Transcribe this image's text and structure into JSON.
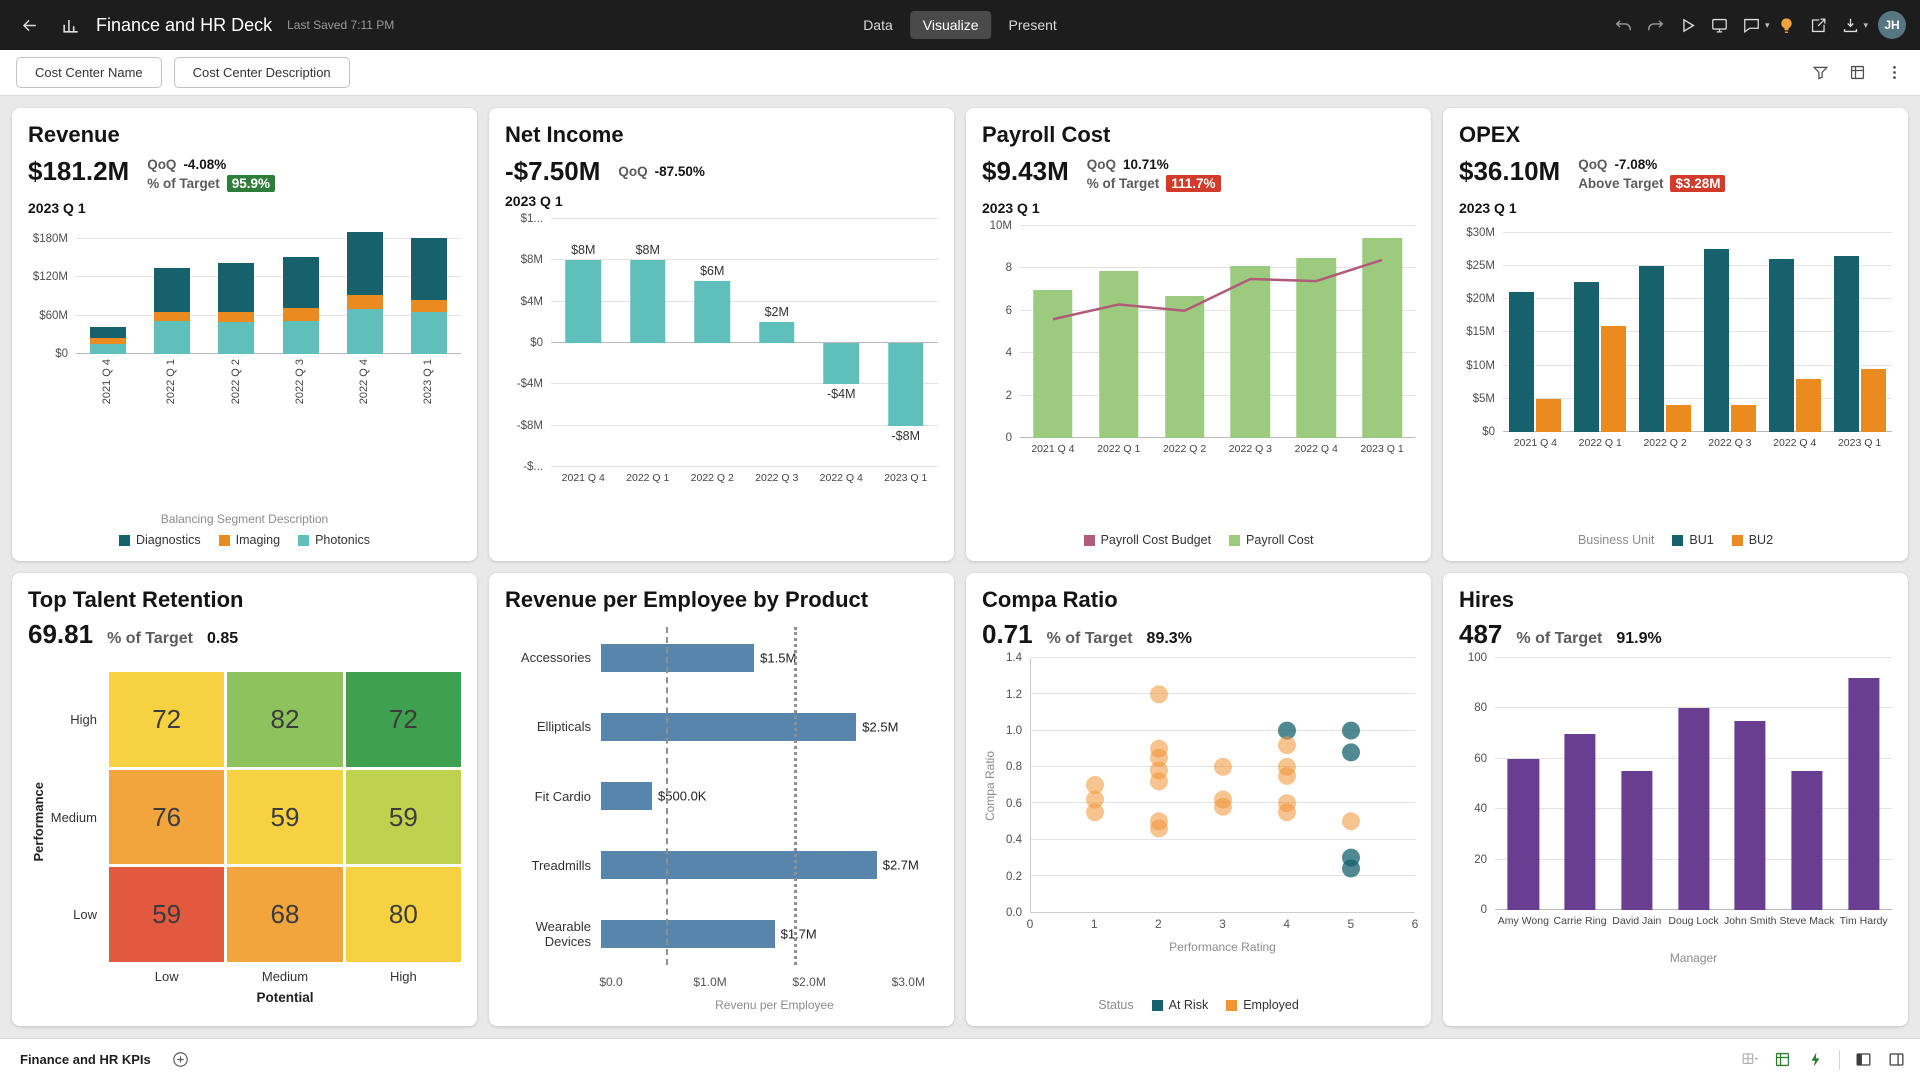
{
  "header": {
    "title": "Finance and HR Deck",
    "last_saved": "Last Saved 7:11 PM",
    "tabs": [
      {
        "label": "Data",
        "active": false
      },
      {
        "label": "Visualize",
        "active": true
      },
      {
        "label": "Present",
        "active": false
      }
    ],
    "avatar_initials": "JH"
  },
  "filter_bar": {
    "chips": [
      {
        "label": "Cost Center Name"
      },
      {
        "label": "Cost Center Description"
      }
    ]
  },
  "footer": {
    "active_tab": "Finance and HR KPIs"
  },
  "icons": {
    "back": "arrow-left",
    "logo": "bar-chart",
    "undo": "undo-arrow",
    "redo": "redo-arrow",
    "play": "play-triangle",
    "present": "screen",
    "comments": "speech-bubble",
    "insights": "lightbulb",
    "export": "open-external",
    "save": "save-download",
    "filter": "funnel",
    "data-settings": "grid",
    "more": "kebab",
    "add-canvas": "plus-circle",
    "refresh": "grid-caret",
    "auto-insights": "bolt",
    "panel-left": "layout-left",
    "panel-right": "layout-right"
  },
  "cards": {
    "revenue": {
      "title": "Revenue",
      "value": "$181.2M",
      "qoq_label": "QoQ",
      "qoq_value": "-4.08%",
      "target_label": "% of Target",
      "target_value": "95.9%",
      "period": "2023 Q 1"
    },
    "net_income": {
      "title": "Net Income",
      "value": "-$7.50M",
      "qoq_label": "QoQ",
      "qoq_value": "-87.50%",
      "period": "2023 Q 1"
    },
    "payroll": {
      "title": "Payroll Cost",
      "value": "$9.43M",
      "qoq_label": "QoQ",
      "qoq_value": "10.71%",
      "target_label": "% of Target",
      "target_value": "111.7%",
      "period": "2023 Q 1"
    },
    "opex": {
      "title": "OPEX",
      "value": "$36.10M",
      "qoq_label": "QoQ",
      "qoq_value": "-7.08%",
      "target_label": "Above Target",
      "target_value": "$3.28M",
      "period": "2023 Q 1"
    },
    "retention": {
      "title": "Top Talent Retention",
      "value": "69.81",
      "target_label": "% of Target",
      "target_value": "0.85"
    },
    "rev_per_employee": {
      "title": "Revenue per Employee by Product"
    },
    "compa": {
      "title": "Compa Ratio",
      "value": "0.71",
      "target_label": "% of Target",
      "target_value": "89.3%"
    },
    "hires": {
      "title": "Hires",
      "value": "487",
      "target_label": "% of Target",
      "target_value": "91.9%"
    }
  },
  "chart_data": [
    {
      "id": "revenue",
      "type": "bar",
      "variant": "stacked",
      "title": "Revenue",
      "categories": [
        "2021 Q 4",
        "2022 Q 1",
        "2022 Q 2",
        "2022 Q 3",
        "2022 Q 4",
        "2023 Q 1"
      ],
      "series": [
        {
          "name": "Photonics",
          "color": "#5FBFBB",
          "values": [
            15,
            52,
            50,
            52,
            70,
            65
          ]
        },
        {
          "name": "Imaging",
          "color": "#EB8A1E",
          "values": [
            10,
            14,
            16,
            20,
            22,
            20
          ]
        },
        {
          "name": "Diagnostics",
          "color": "#17616D",
          "values": [
            18,
            68,
            76,
            80,
            98,
            96
          ]
        }
      ],
      "ylim": [
        0,
        200
      ],
      "yticks": [
        {
          "v": 0,
          "label": "$0"
        },
        {
          "v": 60,
          "label": "$60M"
        },
        {
          "v": 120,
          "label": "$120M"
        },
        {
          "v": 180,
          "label": "$180M"
        }
      ],
      "legend_title": "Balancing Segment Description",
      "legend": [
        {
          "label": "Diagnostics",
          "color": "#17616D"
        },
        {
          "label": "Imaging",
          "color": "#EB8A1E"
        },
        {
          "label": "Photonics",
          "color": "#5FBFBB"
        }
      ]
    },
    {
      "id": "net_income",
      "type": "bar",
      "variant": "single",
      "title": "Net Income",
      "categories": [
        "2021 Q 4",
        "2022 Q 1",
        "2022 Q 2",
        "2022 Q 3",
        "2022 Q 4",
        "2023 Q 1"
      ],
      "values": [
        8,
        8,
        6,
        2,
        -4,
        -8
      ],
      "value_labels": [
        "$8M",
        "$8M",
        "$6M",
        "$2M",
        "-$4M",
        "-$8M"
      ],
      "bar_color": "#5FBFBB",
      "ylim": [
        -12,
        12
      ],
      "yticks": [
        {
          "v": 12,
          "label": "$1..."
        },
        {
          "v": 8,
          "label": "$8M"
        },
        {
          "v": 4,
          "label": "$4M"
        },
        {
          "v": 0,
          "label": "$0"
        },
        {
          "v": -4,
          "label": "-$4M"
        },
        {
          "v": -8,
          "label": "-$8M"
        },
        {
          "v": -12,
          "label": "-$..."
        }
      ]
    },
    {
      "id": "payroll",
      "type": "combo",
      "title": "Payroll Cost",
      "categories": [
        "2021 Q 4",
        "2022 Q 1",
        "2022 Q 2",
        "2022 Q 3",
        "2022 Q 4",
        "2023 Q 1"
      ],
      "bars": {
        "name": "Payroll Cost",
        "color": "#9CCB7F",
        "values": [
          7.0,
          7.9,
          6.7,
          8.1,
          8.5,
          9.43
        ]
      },
      "line": {
        "name": "Payroll Cost Budget",
        "color": "#B05B78",
        "values": [
          5.6,
          6.3,
          6.0,
          7.5,
          7.4,
          8.4
        ]
      },
      "ylim": [
        0,
        10
      ],
      "yticks": [
        {
          "v": 10,
          "label": "10M"
        },
        {
          "v": 8,
          "label": "8"
        },
        {
          "v": 6,
          "label": "6"
        },
        {
          "v": 4,
          "label": "4"
        },
        {
          "v": 2,
          "label": "2"
        },
        {
          "v": 0,
          "label": "0"
        }
      ],
      "legend": [
        {
          "label": "Payroll Cost Budget",
          "color": "#B05B78"
        },
        {
          "label": "Payroll Cost",
          "color": "#9CCB7F"
        }
      ]
    },
    {
      "id": "opex",
      "type": "bar",
      "variant": "grouped",
      "title": "OPEX",
      "categories": [
        "2021 Q 4",
        "2022 Q 1",
        "2022 Q 2",
        "2022 Q 3",
        "2022 Q 4",
        "2023 Q 1"
      ],
      "series": [
        {
          "name": "BU1",
          "color": "#17616D",
          "values": [
            21,
            22.5,
            25,
            27.5,
            26,
            26.5
          ]
        },
        {
          "name": "BU2",
          "color": "#EB8A1E",
          "values": [
            5,
            16,
            4,
            4,
            8,
            9.5
          ]
        }
      ],
      "ylim": [
        0,
        31
      ],
      "yticks": [
        {
          "v": 30,
          "label": "$30M"
        },
        {
          "v": 25,
          "label": "$25M"
        },
        {
          "v": 20,
          "label": "$20M"
        },
        {
          "v": 15,
          "label": "$15M"
        },
        {
          "v": 10,
          "label": "$10M"
        },
        {
          "v": 5,
          "label": "$5M"
        },
        {
          "v": 0,
          "label": "$0"
        }
      ],
      "legend_title": "Business Unit",
      "legend": [
        {
          "label": "BU1",
          "color": "#17616D"
        },
        {
          "label": "BU2",
          "color": "#EB8A1E"
        }
      ]
    },
    {
      "id": "retention",
      "type": "heatmap",
      "title": "Top Talent Retention",
      "row_labels": [
        "High",
        "Medium",
        "Low"
      ],
      "col_labels": [
        "Low",
        "Medium",
        "High"
      ],
      "ylabel": "Performance",
      "xlabel": "Potential",
      "cells": [
        [
          {
            "value": 72,
            "color": "#F6D243"
          },
          {
            "value": 82,
            "color": "#8DC25C"
          },
          {
            "value": 72,
            "color": "#3FA14F"
          }
        ],
        [
          {
            "value": 76,
            "color": "#F2A53C"
          },
          {
            "value": 59,
            "color": "#F6D243"
          },
          {
            "value": 59,
            "color": "#BFD24F"
          }
        ],
        [
          {
            "value": 59,
            "color": "#E2593F"
          },
          {
            "value": 68,
            "color": "#F2A53C"
          },
          {
            "value": 80,
            "color": "#F6D243"
          }
        ]
      ]
    },
    {
      "id": "rev_per_employee",
      "type": "bar",
      "variant": "horizontal",
      "title": "Revenue per Employee by Product",
      "categories": [
        "Accessories",
        "Ellipticals",
        "Fit Cardio",
        "Treadmills",
        "Wearable Devices"
      ],
      "values": [
        1.5,
        2.5,
        0.5,
        2.7,
        1.7
      ],
      "value_labels": [
        "$1.5M",
        "$2.5M",
        "$500.0K",
        "$2.7M",
        "$1.7M"
      ],
      "bar_color": "#5785AC",
      "xlim": [
        0,
        3.3
      ],
      "xticks": [
        {
          "v": 0,
          "label": "$0.0"
        },
        {
          "v": 1,
          "label": "$1.0M"
        },
        {
          "v": 2,
          "label": "$2.0M"
        },
        {
          "v": 3,
          "label": "$3.0M"
        }
      ],
      "ref_lines": [
        {
          "v": 0.55,
          "style": "dashed"
        },
        {
          "v": 1.85,
          "style": "dotted"
        }
      ],
      "xlabel": "Revenu per Employee"
    },
    {
      "id": "compa",
      "type": "scatter",
      "title": "Compa Ratio",
      "xlabel": "Performance Rating",
      "ylabel": "Compa Ratio",
      "xlim": [
        0,
        6
      ],
      "ylim": [
        0,
        1.4
      ],
      "xticks": [
        0,
        1,
        2,
        3,
        4,
        5,
        6
      ],
      "yticks": [
        0.0,
        0.2,
        0.4,
        0.6,
        0.8,
        1.0,
        1.2,
        1.4
      ],
      "series": [
        {
          "name": "At Risk",
          "color": "#17616D",
          "points": [
            [
              4,
              1.0
            ],
            [
              5,
              1.0
            ],
            [
              5,
              0.88
            ],
            [
              5,
              0.3
            ],
            [
              5,
              0.24
            ]
          ]
        },
        {
          "name": "Employed",
          "color": "#F09435",
          "points": [
            [
              1,
              0.7
            ],
            [
              1,
              0.62
            ],
            [
              1,
              0.55
            ],
            [
              2,
              1.2
            ],
            [
              2,
              0.9
            ],
            [
              2,
              0.85
            ],
            [
              2,
              0.78
            ],
            [
              2,
              0.72
            ],
            [
              2,
              0.5
            ],
            [
              2,
              0.46
            ],
            [
              3,
              0.8
            ],
            [
              3,
              0.62
            ],
            [
              3,
              0.58
            ],
            [
              4,
              0.92
            ],
            [
              4,
              0.8
            ],
            [
              4,
              0.75
            ],
            [
              4,
              0.6
            ],
            [
              4,
              0.55
            ],
            [
              5,
              0.5
            ]
          ]
        }
      ],
      "legend_title": "Status",
      "legend": [
        {
          "label": "At Risk",
          "color": "#17616D"
        },
        {
          "label": "Employed",
          "color": "#F09435"
        }
      ]
    },
    {
      "id": "hires",
      "type": "bar",
      "variant": "single",
      "title": "Hires",
      "categories": [
        "Amy Wong",
        "Carrie Ring",
        "David Jain",
        "Doug Lock",
        "John Smith",
        "Steve Mack",
        "Tim Hardy"
      ],
      "values": [
        60,
        70,
        55,
        80,
        75,
        55,
        92
      ],
      "bar_color": "#693D8F",
      "ylim": [
        0,
        100
      ],
      "yticks": [
        {
          "v": 100,
          "label": "100"
        },
        {
          "v": 80,
          "label": "80"
        },
        {
          "v": 60,
          "label": "60"
        },
        {
          "v": 40,
          "label": "40"
        },
        {
          "v": 20,
          "label": "20"
        },
        {
          "v": 0,
          "label": "0"
        }
      ],
      "xlabel": "Manager"
    }
  ]
}
